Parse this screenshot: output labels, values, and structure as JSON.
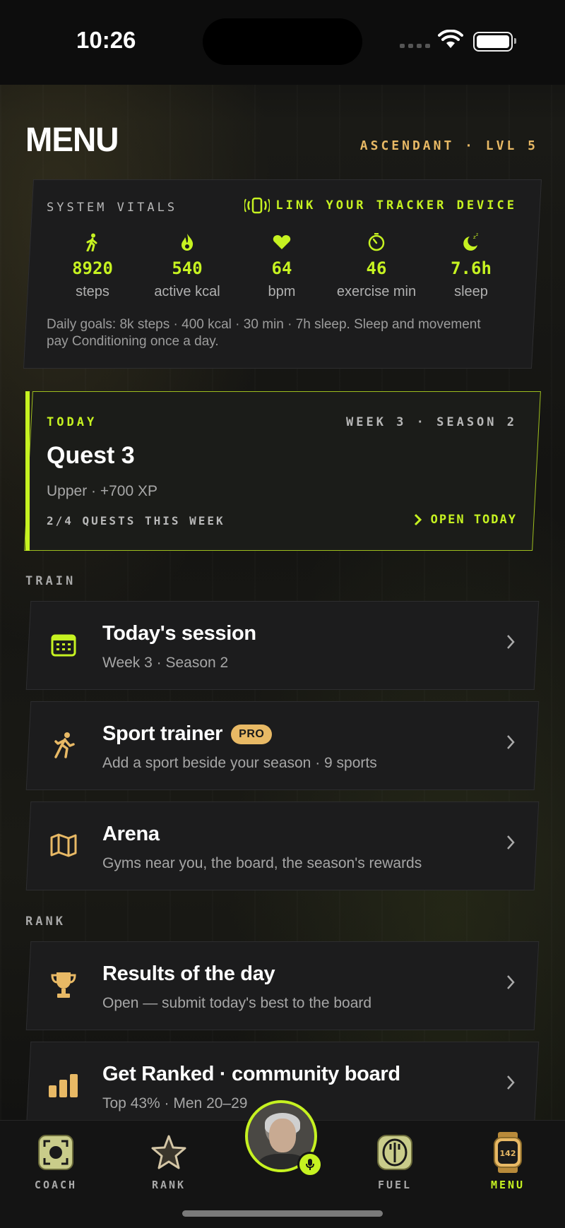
{
  "status_bar": {
    "time": "10:26"
  },
  "header": {
    "title": "MENU",
    "rank": "ASCENDANT · LVL 5"
  },
  "vitals": {
    "heading": "SYSTEM VITALS",
    "link_label": "LINK YOUR TRACKER DEVICE",
    "items": [
      {
        "icon": "walk-icon",
        "value": "8920",
        "label": "steps"
      },
      {
        "icon": "flame-icon",
        "value": "540",
        "label": "active kcal"
      },
      {
        "icon": "heart-icon",
        "value": "64",
        "label": "bpm"
      },
      {
        "icon": "timer-icon",
        "value": "46",
        "label": "exercise min"
      },
      {
        "icon": "moon-icon",
        "value": "7.6h",
        "label": "sleep"
      }
    ],
    "note": "Daily goals: 8k steps · 400 kcal · 30 min · 7h sleep. Sleep and movement pay Conditioning once a day."
  },
  "quest": {
    "today": "TODAY",
    "week": "WEEK 3 · SEASON 2",
    "title": "Quest 3",
    "subtitle": "Upper · +700 XP",
    "count": "2/4 QUESTS THIS WEEK",
    "open": "OPEN TODAY"
  },
  "sections": {
    "train": "TRAIN",
    "rank": "RANK"
  },
  "train_rows": [
    {
      "icon": "calendar-icon",
      "title": "Today's session",
      "subtitle": "Week 3 · Season 2"
    },
    {
      "icon": "runner-icon",
      "title": "Sport trainer",
      "badge": "PRO",
      "subtitle": "Add a sport beside your season · 9 sports"
    },
    {
      "icon": "map-icon",
      "title": "Arena",
      "subtitle": "Gyms near you, the board, the season's rewards"
    }
  ],
  "rank_rows": [
    {
      "icon": "trophy-icon",
      "title": "Results of the day",
      "subtitle": "Open — submit today's best to the board"
    },
    {
      "icon": "bar-chart-icon",
      "title": "Get Ranked · community board",
      "subtitle": "Top 43% · Men 20–29"
    }
  ],
  "tabs": [
    {
      "icon": "coach-icon",
      "label": "COACH"
    },
    {
      "icon": "star-icon",
      "label": "RANK"
    },
    {
      "icon": "fuel-icon",
      "label": "FUEL"
    },
    {
      "icon": "watch-icon",
      "label": "MENU",
      "watch_text": "142",
      "active": true
    }
  ],
  "colors": {
    "accent": "#c6f221",
    "gold": "#e8b965",
    "card": "#1c1c1d"
  }
}
